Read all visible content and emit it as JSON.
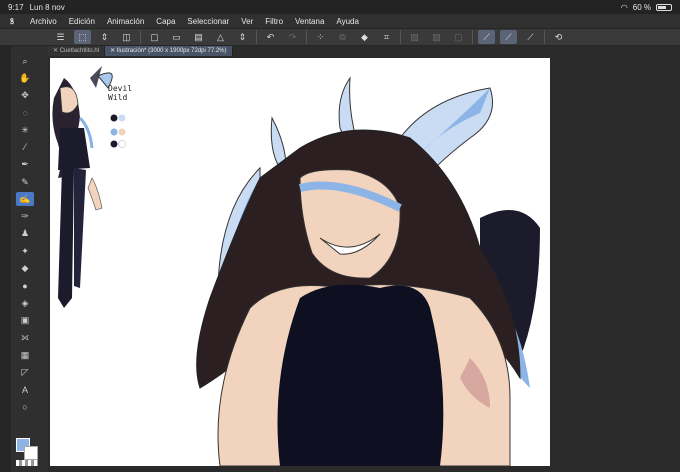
{
  "status": {
    "time": "9:17",
    "date": "Lun 8 nov",
    "battery": "60 %",
    "battery_level": 0.6
  },
  "menu": {
    "items": [
      "Archivo",
      "Edición",
      "Animación",
      "Capa",
      "Seleccionar",
      "Ver",
      "Filtro",
      "Ventana",
      "Ayuda"
    ]
  },
  "tabs": [
    {
      "label": "Cuetlachtlito.hl"
    },
    {
      "label": "Ilustración* (3000 x 1900px 72dpi 77.2%)"
    }
  ],
  "canvas": {
    "note_line1": "Devil",
    "note_line2": "Wild"
  },
  "colors": {
    "main": "#8db4e6",
    "sub": "#ffffff",
    "accent": "#4b79c8"
  },
  "icons": {
    "toolbar": [
      "menu-icon",
      "transform-icon",
      "undo-redo-stepper-icon",
      "layer-icon",
      "new-canvas-icon",
      "open-icon",
      "save-icon",
      "export-icon",
      "stepper-icon",
      "undo-icon",
      "redo-icon",
      "lasso-icon",
      "fill-icon",
      "bucket-icon",
      "crop-icon",
      "clear-icon",
      "invert-icon",
      "deselect-icon",
      "ruler-icon",
      "pen-ruler-icon",
      "line-ruler-icon",
      "snap-icon"
    ],
    "tools": [
      "zoom-icon",
      "hand-icon",
      "move-icon",
      "lasso-icon",
      "magic-wand-icon",
      "eyedropper-icon",
      "pen-icon",
      "pencil-icon",
      "brush-icon",
      "airbrush-icon",
      "decorate-icon",
      "eraser-icon",
      "blend-icon",
      "fill-icon",
      "gradient-icon",
      "figure-icon",
      "frame-icon",
      "ruler-icon",
      "text-icon",
      "balloon-icon"
    ]
  }
}
